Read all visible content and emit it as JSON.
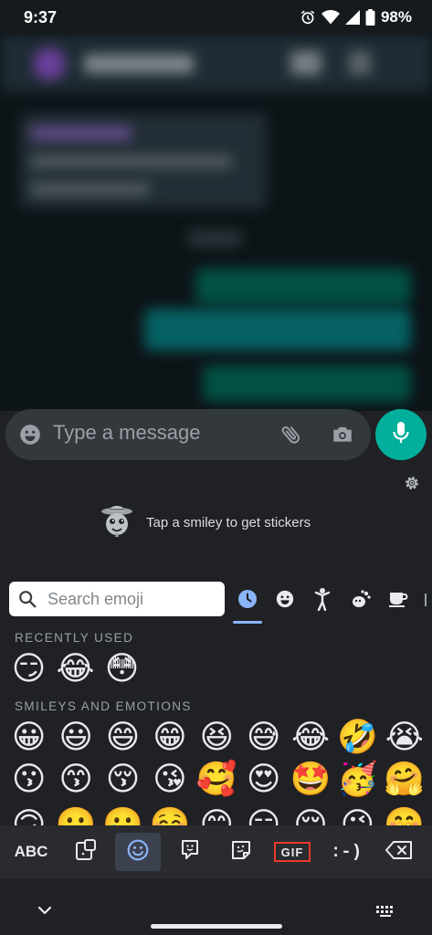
{
  "status_bar": {
    "time": "9:37",
    "battery": "98%",
    "icons": [
      "alarm-icon",
      "wifi-icon",
      "signal-icon",
      "battery-icon"
    ]
  },
  "message_bar": {
    "placeholder": "Type a message",
    "icons": [
      "smiley-icon",
      "attach-icon",
      "camera-icon",
      "mic-icon"
    ],
    "accent_color": "#00af9c"
  },
  "keyboard": {
    "sticker_hint": "Tap a smiley to get stickers",
    "search_placeholder": "Search emoji",
    "category_tabs": [
      "recent-icon",
      "smileys-icon",
      "people-icon",
      "animals-icon",
      "food-icon"
    ],
    "active_tab": "recent-icon",
    "recently_used_title": "RECENTLY USED",
    "recently_used": [
      "😏",
      "😂",
      "😳"
    ],
    "smileys_title": "SMILEYS AND EMOTIONS",
    "smileys_rows": [
      [
        "😀",
        "😃",
        "😄",
        "😁",
        "😆",
        "😅",
        "😂",
        "🤣",
        "😭"
      ],
      [
        "😗",
        "😙",
        "😚",
        "😘",
        "🥰",
        "😍",
        "🤩",
        "🥳",
        "🤗"
      ],
      [
        "🙃",
        "🙂",
        "🥲",
        "☺️",
        "😊",
        "😏",
        "😌",
        "😉",
        "🤭"
      ]
    ],
    "toolbar": {
      "abc_label": "ABC",
      "gif_label": "GIF",
      "emoticon_label": ":-)",
      "active_item": "emoji",
      "highlight_color": "#e8392b"
    }
  }
}
